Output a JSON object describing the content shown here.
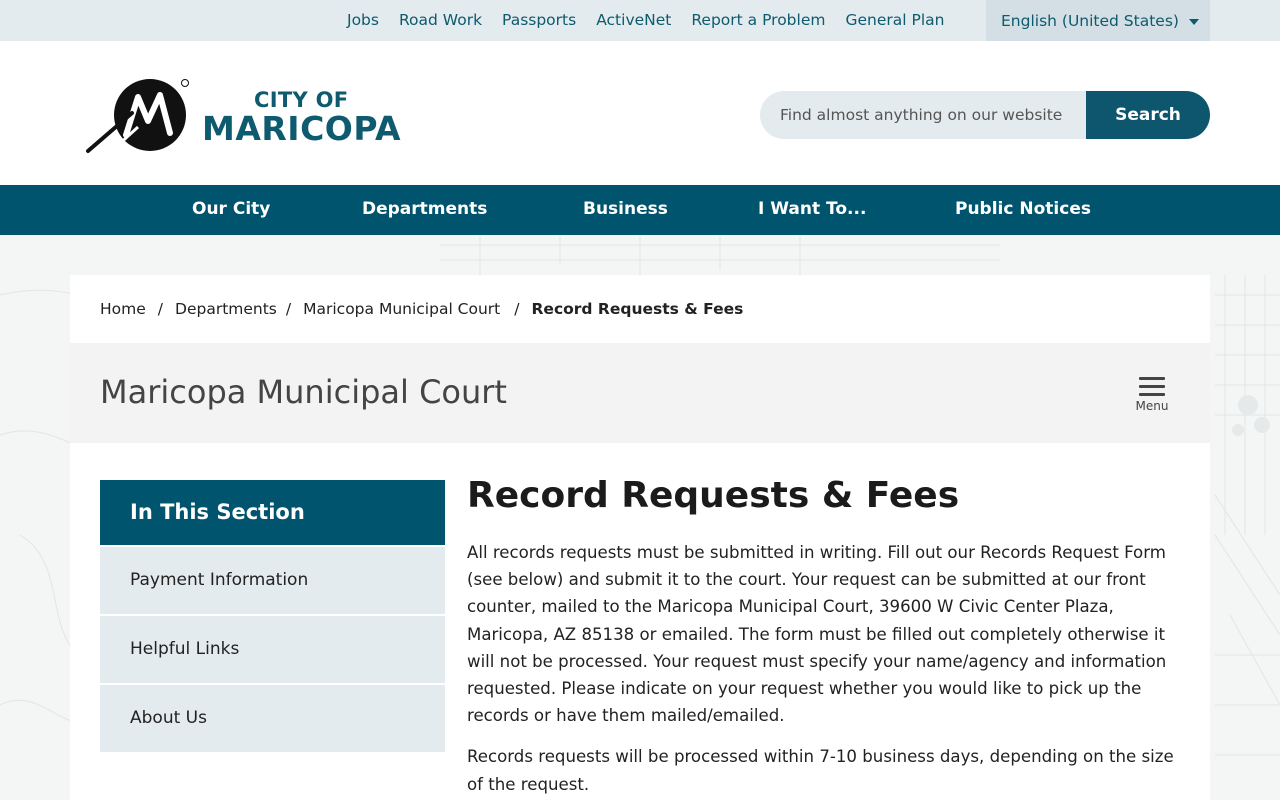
{
  "utility": {
    "links": [
      "Jobs",
      "Road Work",
      "Passports",
      "ActiveNet",
      "Report a Problem",
      "General Plan"
    ],
    "language": "English (United States)"
  },
  "header": {
    "logo_city": "CITY OF",
    "logo_name": "MARICOPA",
    "search_placeholder": "Find almost anything on our website",
    "search_button": "Search"
  },
  "nav": {
    "items": [
      "Our City",
      "Departments",
      "Business",
      "I Want To...",
      "Public Notices"
    ]
  },
  "breadcrumb": {
    "items": [
      "Home",
      "Departments",
      "Maricopa Municipal Court"
    ],
    "separator": "/",
    "current": "Record Requests & Fees"
  },
  "department": {
    "title": "Maricopa Municipal Court",
    "menu_label": "Menu"
  },
  "section_nav": {
    "heading": "In This Section",
    "items": [
      "Payment Information",
      "Helpful Links",
      "About Us"
    ]
  },
  "article": {
    "title": "Record Requests & Fees",
    "paragraphs": [
      "All records requests must be submitted in writing. Fill out our Records Request Form (see below) and submit it to the court. Your request can be submitted at our front counter, mailed to the Maricopa Municipal Court, 39600 W Civic Center Plaza, Maricopa, AZ 85138 or emailed. The form must be filled out completely otherwise it will not be processed. Your request must specify your name/agency and information requested. Please indicate on your request whether you would like to pick up the records or have them mailed/emailed.",
      "Records requests will be processed within 7-10 business days, depending on the size of the request."
    ]
  },
  "colors": {
    "primary": "#00546e",
    "link": "#0e5a6e",
    "utility_bg": "#e3ebee"
  }
}
